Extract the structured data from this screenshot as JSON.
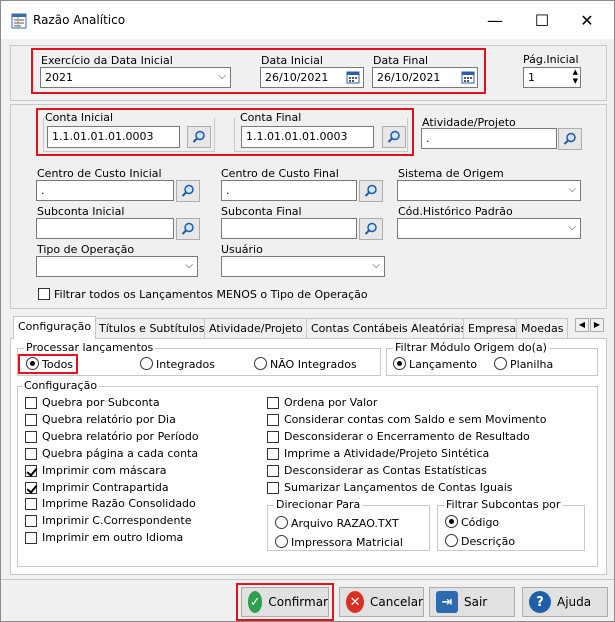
{
  "window": {
    "title": "Razão Analítico",
    "minimize": "—",
    "maximize": "☐",
    "close": "✕"
  },
  "header": {
    "exercicio_label": "Exercício da Data Inicial",
    "exercicio_value": "2021",
    "data_inicial_label": "Data Inicial",
    "data_inicial_value": "26/10/2021",
    "data_final_label": "Data Final",
    "data_final_value": "26/10/2021",
    "pag_inicial_label": "Pág.Inicial",
    "pag_inicial_value": "1"
  },
  "filters": {
    "conta_inicial_label": "Conta Inicial",
    "conta_inicial_value": "1.1.01.01.01.0003",
    "conta_final_label": "Conta Final",
    "conta_final_value": "1.1.01.01.01.0003",
    "atividade_label": "Atividade/Projeto",
    "atividade_value": ".",
    "cc_inicial_label": "Centro de Custo Inicial",
    "cc_inicial_value": ".",
    "cc_final_label": "Centro de Custo Final",
    "cc_final_value": ".",
    "sistema_origem_label": "Sistema de Origem",
    "subconta_inicial_label": "Subconta Inicial",
    "subconta_final_label": "Subconta Final",
    "cod_historico_label": "Cód.Histórico Padrão",
    "tipo_operacao_label": "Tipo de Operação",
    "usuario_label": "Usuário",
    "filtrar_label": "Filtrar todos os Lançamentos MENOS o Tipo de Operação"
  },
  "tabs": [
    "Configuração",
    "Títulos e Subtítulos",
    "Atividade/Projeto",
    "Contas Contábeis Aleatórias",
    "Empresa",
    "Moedas"
  ],
  "processar": {
    "title": "Processar lançamentos",
    "todos": "Todos",
    "integrados": "Integrados",
    "nao_integrados": "NÃO Integrados"
  },
  "filtrar_modulo": {
    "title": "Filtrar Módulo Origem do(a)",
    "lancamento": "Lançamento",
    "planilha": "Planilha"
  },
  "config": {
    "title": "Configuração",
    "left": [
      {
        "label": "Quebra por Subconta",
        "checked": false
      },
      {
        "label": "Quebra relatório por Dia",
        "checked": false
      },
      {
        "label": "Quebra relatório por Período",
        "checked": false
      },
      {
        "label": "Quebra página a cada conta",
        "checked": false
      },
      {
        "label": "Imprimir com máscara",
        "checked": true
      },
      {
        "label": "Imprimir Contrapartida",
        "checked": true
      },
      {
        "label": "Imprime Razão Consolidado",
        "checked": false
      },
      {
        "label": "Imprimir C.Correspondente",
        "checked": false
      },
      {
        "label": "Imprimir em outro Idioma",
        "checked": false
      }
    ],
    "right": [
      {
        "label": "Ordena por Valor",
        "checked": false
      },
      {
        "label": "Considerar contas com Saldo e sem Movimento",
        "checked": false
      },
      {
        "label": "Desconsiderar o Encerramento de Resultado",
        "checked": false
      },
      {
        "label": "Imprime a Atividade/Projeto Sintética",
        "checked": false
      },
      {
        "label": "Desconsiderar as Contas Estatísticas",
        "checked": false
      },
      {
        "label": "Sumarizar Lançamentos de Contas Iguais",
        "checked": false
      }
    ]
  },
  "direcionar": {
    "title": "Direcionar  Para",
    "arquivo": "Arquivo RAZAO.TXT",
    "impressora": "Impressora Matricial"
  },
  "filtrar_subcontas": {
    "title": "Filtrar Subcontas por",
    "codigo": "Código",
    "descricao": "Descrição"
  },
  "buttons": {
    "confirmar": "Confirmar",
    "cancelar": "Cancelar",
    "sair": "Sair",
    "ajuda": "Ajuda"
  },
  "colors": {
    "highlight": "#e0141c",
    "confirm_green": "#2e9e4f",
    "cancel_red": "#d93025",
    "exit_blue": "#2b6cb0",
    "help_blue": "#1f5fa8"
  }
}
